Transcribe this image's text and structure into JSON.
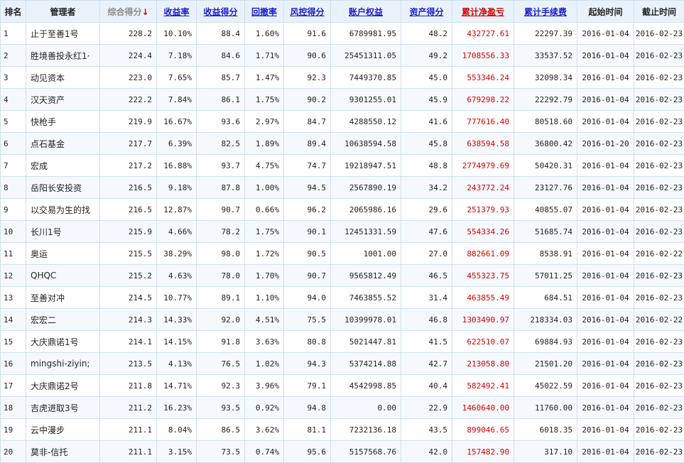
{
  "headers": {
    "rank": "排名",
    "manager": "管理者",
    "score": "综合得分",
    "score_arrow": "↓",
    "return_rate": "收益率",
    "return_score": "收益得分",
    "drawdown": "回撤率",
    "risk_score": "风控得分",
    "equity": "账户权益",
    "asset_score": "资产得分",
    "cum_pnl": "累计净盈亏",
    "cum_fee": "累计手续费",
    "start": "起始时间",
    "end": "截止时间"
  },
  "colors": {
    "header_bg": "#e9f2fb",
    "link_blue": "#1c1cc8",
    "profit_red": "#d40000",
    "row_alt": "#f5f9fd",
    "border": "#cfe0ee"
  },
  "rows": [
    {
      "rank": "1",
      "manager": "止于至善1号",
      "score": "228.2",
      "return_rate": "10.10%",
      "return_score": "88.4",
      "drawdown": "1.60%",
      "risk_score": "91.6",
      "equity": "6789981.95",
      "asset_score": "48.2",
      "cum_pnl": "432727.61",
      "cum_fee": "22297.39",
      "start": "2016-01-04",
      "end": "2016-02-23"
    },
    {
      "rank": "2",
      "manager": "胜境善投永红1·",
      "score": "224.4",
      "return_rate": "7.18%",
      "return_score": "84.6",
      "drawdown": "1.71%",
      "risk_score": "90.6",
      "equity": "25451311.05",
      "asset_score": "49.2",
      "cum_pnl": "1708556.33",
      "cum_fee": "33537.52",
      "start": "2016-01-04",
      "end": "2016-02-23"
    },
    {
      "rank": "3",
      "manager": "动见资本",
      "score": "223.0",
      "return_rate": "7.65%",
      "return_score": "85.7",
      "drawdown": "1.47%",
      "risk_score": "92.3",
      "equity": "7449370.85",
      "asset_score": "45.0",
      "cum_pnl": "553346.24",
      "cum_fee": "32098.34",
      "start": "2016-01-04",
      "end": "2016-02-23"
    },
    {
      "rank": "4",
      "manager": "汉天资产",
      "score": "222.2",
      "return_rate": "7.84%",
      "return_score": "86.1",
      "drawdown": "1.75%",
      "risk_score": "90.2",
      "equity": "9301255.01",
      "asset_score": "45.9",
      "cum_pnl": "679298.22",
      "cum_fee": "22292.79",
      "start": "2016-01-04",
      "end": "2016-02-23"
    },
    {
      "rank": "5",
      "manager": "快枪手",
      "score": "219.9",
      "return_rate": "16.67%",
      "return_score": "93.6",
      "drawdown": "2.97%",
      "risk_score": "84.7",
      "equity": "4288550.12",
      "asset_score": "41.6",
      "cum_pnl": "777616.40",
      "cum_fee": "80518.60",
      "start": "2016-01-04",
      "end": "2016-02-23"
    },
    {
      "rank": "6",
      "manager": "点石基金",
      "score": "217.7",
      "return_rate": "6.39%",
      "return_score": "82.5",
      "drawdown": "1.89%",
      "risk_score": "89.4",
      "equity": "10638594.58",
      "asset_score": "45.8",
      "cum_pnl": "638594.58",
      "cum_fee": "36800.42",
      "start": "2016-01-20",
      "end": "2016-02-23"
    },
    {
      "rank": "7",
      "manager": "宏成",
      "score": "217.2",
      "return_rate": "16.88%",
      "return_score": "93.7",
      "drawdown": "4.75%",
      "risk_score": "74.7",
      "equity": "19218947.51",
      "asset_score": "48.8",
      "cum_pnl": "2774979.69",
      "cum_fee": "50420.31",
      "start": "2016-01-04",
      "end": "2016-02-23"
    },
    {
      "rank": "8",
      "manager": "岳阳长安投资",
      "score": "216.5",
      "return_rate": "9.18%",
      "return_score": "87.8",
      "drawdown": "1.00%",
      "risk_score": "94.5",
      "equity": "2567890.19",
      "asset_score": "34.2",
      "cum_pnl": "243772.24",
      "cum_fee": "23127.76",
      "start": "2016-01-04",
      "end": "2016-02-23"
    },
    {
      "rank": "9",
      "manager": "以交易为生的找",
      "score": "216.5",
      "return_rate": "12.87%",
      "return_score": "90.7",
      "drawdown": "0.66%",
      "risk_score": "96.2",
      "equity": "2065986.16",
      "asset_score": "29.6",
      "cum_pnl": "251379.93",
      "cum_fee": "40855.07",
      "start": "2016-01-04",
      "end": "2016-02-23"
    },
    {
      "rank": "10",
      "manager": "长川1号",
      "score": "215.9",
      "return_rate": "4.66%",
      "return_score": "78.2",
      "drawdown": "1.75%",
      "risk_score": "90.1",
      "equity": "12451331.59",
      "asset_score": "47.6",
      "cum_pnl": "554334.26",
      "cum_fee": "51685.74",
      "start": "2016-01-04",
      "end": "2016-02-23"
    },
    {
      "rank": "11",
      "manager": "奥运",
      "score": "215.5",
      "return_rate": "38.29%",
      "return_score": "98.0",
      "drawdown": "1.72%",
      "risk_score": "90.5",
      "equity": "1001.00",
      "asset_score": "27.0",
      "cum_pnl": "882661.09",
      "cum_fee": "8538.91",
      "start": "2016-01-04",
      "end": "2016-02-22"
    },
    {
      "rank": "12",
      "manager": "QHQC",
      "score": "215.2",
      "return_rate": "4.63%",
      "return_score": "78.0",
      "drawdown": "1.70%",
      "risk_score": "90.7",
      "equity": "9565812.49",
      "asset_score": "46.5",
      "cum_pnl": "455323.75",
      "cum_fee": "57011.25",
      "start": "2016-01-04",
      "end": "2016-02-23"
    },
    {
      "rank": "13",
      "manager": "至善对冲",
      "score": "214.5",
      "return_rate": "10.77%",
      "return_score": "89.1",
      "drawdown": "1.10%",
      "risk_score": "94.0",
      "equity": "7463855.52",
      "asset_score": "31.4",
      "cum_pnl": "463855.49",
      "cum_fee": "684.51",
      "start": "2016-01-04",
      "end": "2016-02-23"
    },
    {
      "rank": "14",
      "manager": "宏宏二",
      "score": "214.3",
      "return_rate": "14.33%",
      "return_score": "92.0",
      "drawdown": "4.51%",
      "risk_score": "75.5",
      "equity": "10399978.01",
      "asset_score": "46.8",
      "cum_pnl": "1303490.97",
      "cum_fee": "218334.03",
      "start": "2016-01-04",
      "end": "2016-02-22"
    },
    {
      "rank": "15",
      "manager": "大庆鼎诺1号",
      "score": "214.1",
      "return_rate": "14.15%",
      "return_score": "91.8",
      "drawdown": "3.63%",
      "risk_score": "80.8",
      "equity": "5021447.81",
      "asset_score": "41.5",
      "cum_pnl": "622510.07",
      "cum_fee": "69884.93",
      "start": "2016-01-04",
      "end": "2016-02-23"
    },
    {
      "rank": "16",
      "manager": "mingshi-ziyin;",
      "score": "213.5",
      "return_rate": "4.13%",
      "return_score": "76.5",
      "drawdown": "1.02%",
      "risk_score": "94.3",
      "equity": "5374214.88",
      "asset_score": "42.7",
      "cum_pnl": "213058.80",
      "cum_fee": "21501.20",
      "start": "2016-01-04",
      "end": "2016-02-23"
    },
    {
      "rank": "17",
      "manager": "大庆鼎诺2号",
      "score": "211.8",
      "return_rate": "14.71%",
      "return_score": "92.3",
      "drawdown": "3.96%",
      "risk_score": "79.1",
      "equity": "4542998.85",
      "asset_score": "40.4",
      "cum_pnl": "582492.41",
      "cum_fee": "45022.59",
      "start": "2016-01-04",
      "end": "2016-02-23"
    },
    {
      "rank": "18",
      "manager": "吉虎进取3号",
      "score": "211.2",
      "return_rate": "16.23%",
      "return_score": "93.5",
      "drawdown": "0.92%",
      "risk_score": "94.8",
      "equity": "0.00",
      "asset_score": "22.9",
      "cum_pnl": "1460640.00",
      "cum_fee": "11760.00",
      "start": "2016-01-04",
      "end": "2016-02-23"
    },
    {
      "rank": "19",
      "manager": "云中漫步",
      "score": "211.1",
      "return_rate": "8.04%",
      "return_score": "86.5",
      "drawdown": "3.62%",
      "risk_score": "81.1",
      "equity": "7232136.18",
      "asset_score": "43.5",
      "cum_pnl": "899046.65",
      "cum_fee": "6018.35",
      "start": "2016-01-04",
      "end": "2016-02-23"
    },
    {
      "rank": "20",
      "manager": "莫非-信托",
      "score": "211.1",
      "return_rate": "3.15%",
      "return_score": "73.5",
      "drawdown": "0.74%",
      "risk_score": "95.6",
      "equity": "5157568.76",
      "asset_score": "42.0",
      "cum_pnl": "157482.90",
      "cum_fee": "317.10",
      "start": "2016-01-04",
      "end": "2016-02-23"
    }
  ]
}
